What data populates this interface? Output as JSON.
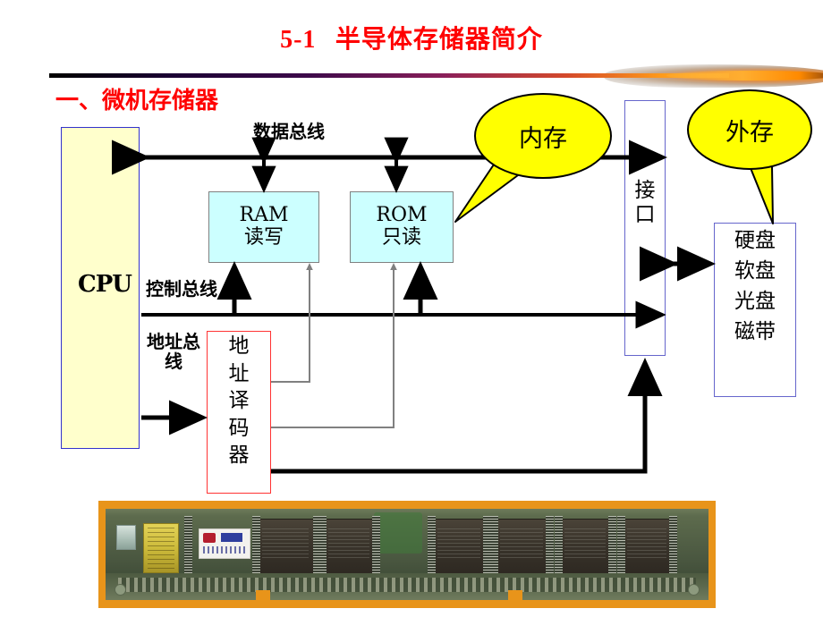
{
  "slide": {
    "title_number": "5-1",
    "title_text": "半导体存储器简介",
    "section_heading": "一、微机存储器"
  },
  "diagram": {
    "cpu": {
      "label": "CPU"
    },
    "buses": {
      "data_bus": "数据总线",
      "control_bus": "控制总线",
      "address_bus": "地址总线"
    },
    "ram": {
      "name": "RAM",
      "desc": "读写"
    },
    "rom": {
      "name": "ROM",
      "desc": "只读"
    },
    "decoder": {
      "label": "地址译码器"
    },
    "interface": {
      "label": "接口"
    },
    "external_storage": {
      "items": [
        "硬盘",
        "软盘",
        "光盘",
        "磁带"
      ]
    },
    "callouts": [
      {
        "label": "内存",
        "points_to": "RAM"
      },
      {
        "label": "外存",
        "points_to": "硬盘软盘光盘磁带"
      }
    ]
  },
  "photo": {
    "caption": "",
    "alt_name": "memory-module-photo"
  },
  "colors": {
    "title_red": "#ff0000",
    "cpu_fill": "#ffffcc",
    "memory_fill": "#ccffff",
    "callout_fill": "#ffff00",
    "decoder_border": "#ff3333",
    "box_border_blue": "#3333cc",
    "photo_frame": "#e8941a"
  }
}
